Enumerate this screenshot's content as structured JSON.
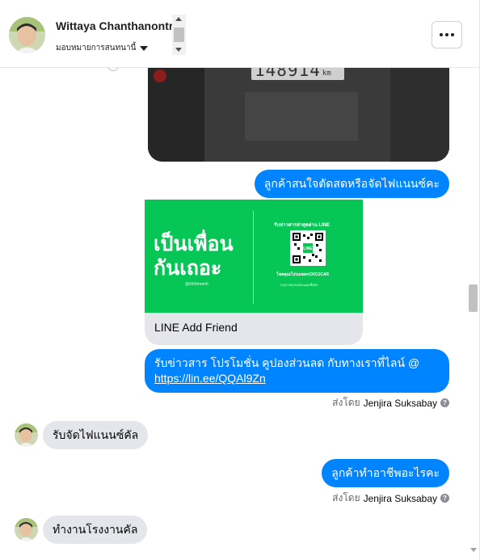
{
  "header": {
    "contact_name": "Wittaya Chanthanontri",
    "assign_label": "มอบหมายการสนทนานี้"
  },
  "photo": {
    "odometer_value": "148914",
    "odometer_unit": "km"
  },
  "messages": {
    "m1": {
      "text": "ลูกค้าสนใจตัดสดหรือจัดไฟแนนซ์คะ"
    },
    "card": {
      "big_line1": "เป็นเพื่อน",
      "big_line2": "กันเถอะ",
      "handle": "@042fmmnh",
      "qr_title": "รับข่าวสารล่าสุดผ่าน LINE",
      "qr_center": "LINE",
      "qr_sub": "โชคคุณโปรเมฆตรCKC2CAR",
      "qr_fine": "กรุณาสแกนQRcodeเพื่อรับ",
      "label": "LINE Add Friend"
    },
    "m2": {
      "text": "รับข่าวสาร  โปรโมชั่น คูปองส่วนลด กับทางเราที่ไลน์ @",
      "link": "https://lin.ee/QQAl9Zn"
    },
    "sent_by_1": {
      "prefix": "ส่งโดย",
      "name": "Jenjira Suksabay"
    },
    "in1": {
      "text": "รับจัดไฟแนนซ์คัล"
    },
    "m3": {
      "text": "ลูกค้าทำอาชีพอะไรคะ"
    },
    "sent_by_2": {
      "prefix": "ส่งโดย",
      "name": "Jenjira Suksabay"
    },
    "in2": {
      "text": "ทำงานโรงงานคัล"
    }
  },
  "colors": {
    "outgoing": "#0084ff",
    "incoming": "#e4e6eb",
    "line_green": "#06c755"
  },
  "icons": [
    "more-icon",
    "caret-down-icon",
    "help-icon",
    "qr-code-icon",
    "seen-icon"
  ]
}
